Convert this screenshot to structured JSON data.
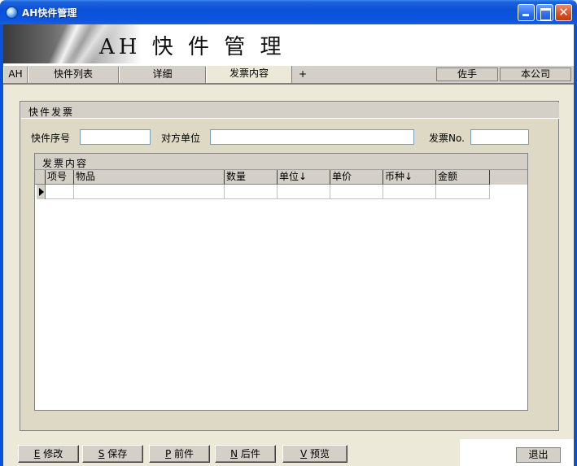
{
  "window": {
    "title": "AH快件管理"
  },
  "banner": {
    "title": "AH 快 件 管 理"
  },
  "tabs": [
    {
      "label": "AH"
    },
    {
      "label": "快件列表"
    },
    {
      "label": "详细"
    },
    {
      "label": "发票内容"
    },
    {
      "label": "+"
    }
  ],
  "right_tabs": [
    {
      "label": "佐手"
    },
    {
      "label": "本公司"
    }
  ],
  "panel": {
    "title": "快件发票",
    "fields": {
      "serial_label": "快件序号",
      "serial_value": "",
      "counterparty_label": "对方单位",
      "counterparty_value": "",
      "invoice_no_label": "发票No.",
      "invoice_no_value": ""
    }
  },
  "grid": {
    "caption": "发票内容",
    "columns": [
      "项号",
      "物品",
      "数量",
      "单位↓",
      "单价",
      "币种↓",
      "金额"
    ]
  },
  "footer": {
    "buttons": [
      {
        "key": "E",
        "label": "修改"
      },
      {
        "key": "S",
        "label": "保存"
      },
      {
        "key": "P",
        "label": "前件"
      },
      {
        "key": "N",
        "label": "后件"
      },
      {
        "key": "V",
        "label": "预览"
      }
    ],
    "exit_label": "退出"
  }
}
